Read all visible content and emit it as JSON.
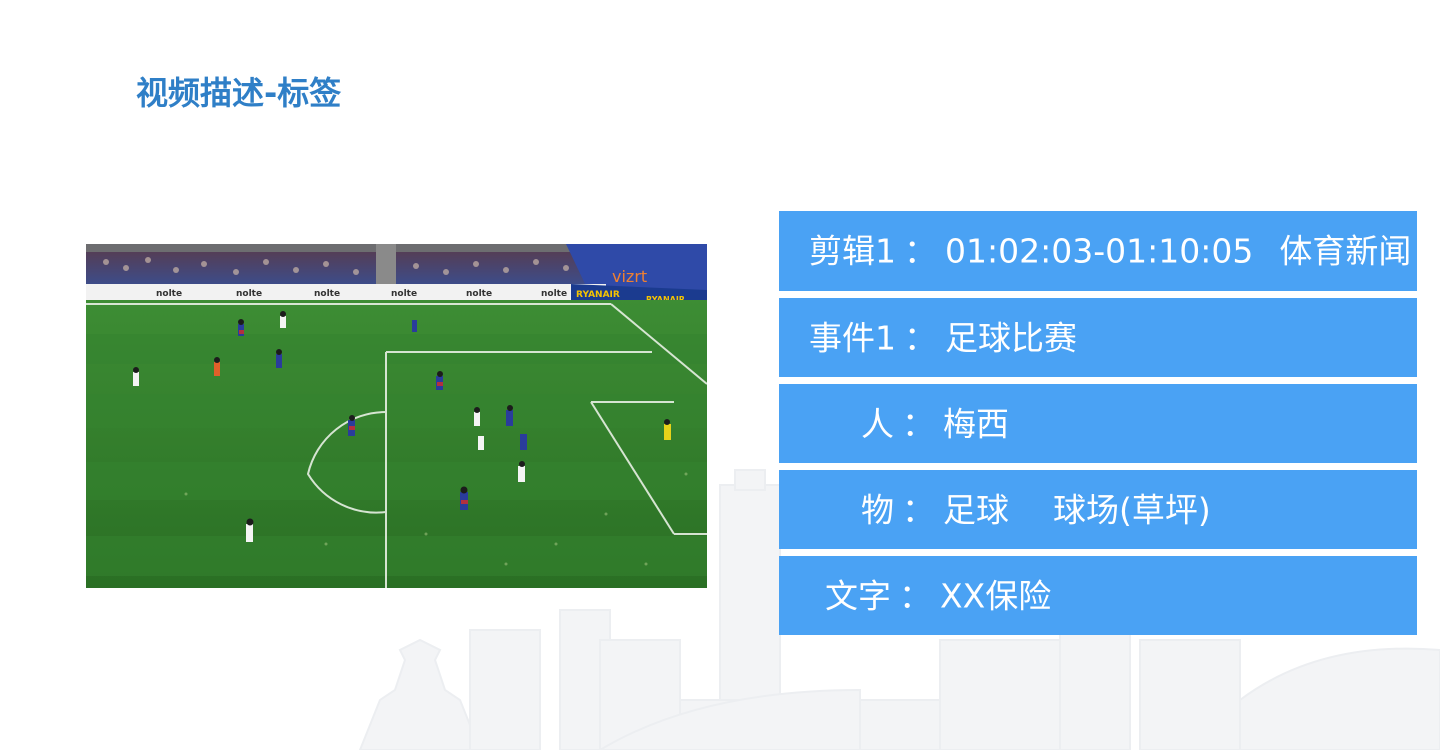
{
  "slide": {
    "title": "视频描述-标签"
  },
  "video": {
    "ad_board_text": "nolte",
    "sponsor_logo": "vizrt",
    "sponsor_banner": "RYANAIR"
  },
  "tags": [
    {
      "label": "剪辑1",
      "separator": "：",
      "value": "01:02:03-01:10:05",
      "extra": "体育新闻"
    },
    {
      "label": "事件1",
      "separator": "：",
      "value": "足球比赛"
    },
    {
      "label": "人",
      "separator": "：",
      "value": "梅西"
    },
    {
      "label": "物",
      "separator": "：",
      "value": "足球",
      "extra": "球场(草坪)"
    },
    {
      "label": "文字",
      "separator": "：",
      "value": "XX保险"
    }
  ],
  "colors": {
    "title": "#2f7fc7",
    "tag_background": "#4aa2f4",
    "tag_text": "#ffffff",
    "pitch": "#2f7a2a"
  }
}
